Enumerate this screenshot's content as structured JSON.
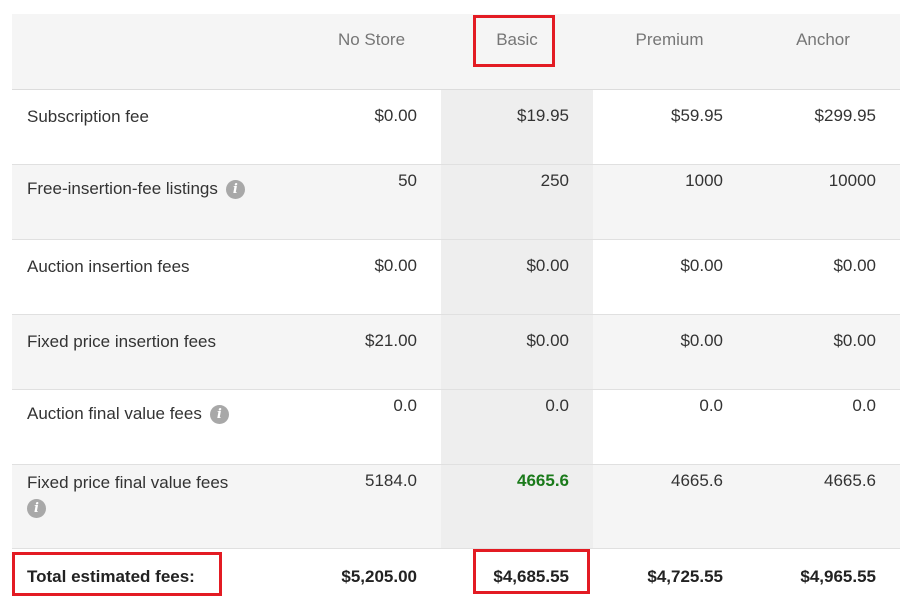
{
  "columns": [
    "No Store",
    "Basic",
    "Premium",
    "Anchor"
  ],
  "rows": [
    {
      "label": "Subscription fee",
      "values": [
        "$0.00",
        "$19.95",
        "$59.95",
        "$299.95"
      ]
    },
    {
      "label": "Free-insertion-fee listings",
      "values": [
        "50",
        "250",
        "1000",
        "10000"
      ],
      "info": true
    },
    {
      "label": "Auction insertion fees",
      "values": [
        "$0.00",
        "$0.00",
        "$0.00",
        "$0.00"
      ]
    },
    {
      "label": "Fixed price insertion fees",
      "values": [
        "$21.00",
        "$0.00",
        "$0.00",
        "$0.00"
      ]
    },
    {
      "label": "Auction final value fees",
      "values": [
        "0.0",
        "0.0",
        "0.0",
        "0.0"
      ],
      "info": true
    },
    {
      "label": "Fixed price final value fees",
      "values": [
        "5184.0",
        "4665.6",
        "4665.6",
        "4665.6"
      ],
      "info": true
    }
  ],
  "total": {
    "label": "Total estimated fees:",
    "values": [
      "$5,205.00",
      "$4,685.55",
      "$4,725.55",
      "$4,965.55"
    ]
  },
  "icons": {
    "info": "info-icon",
    "info_glyph": "i"
  },
  "colors": {
    "highlight_box": "#e31b23",
    "best_value": "#1a7a1a",
    "basic_column_bg": "#eeeeee"
  }
}
